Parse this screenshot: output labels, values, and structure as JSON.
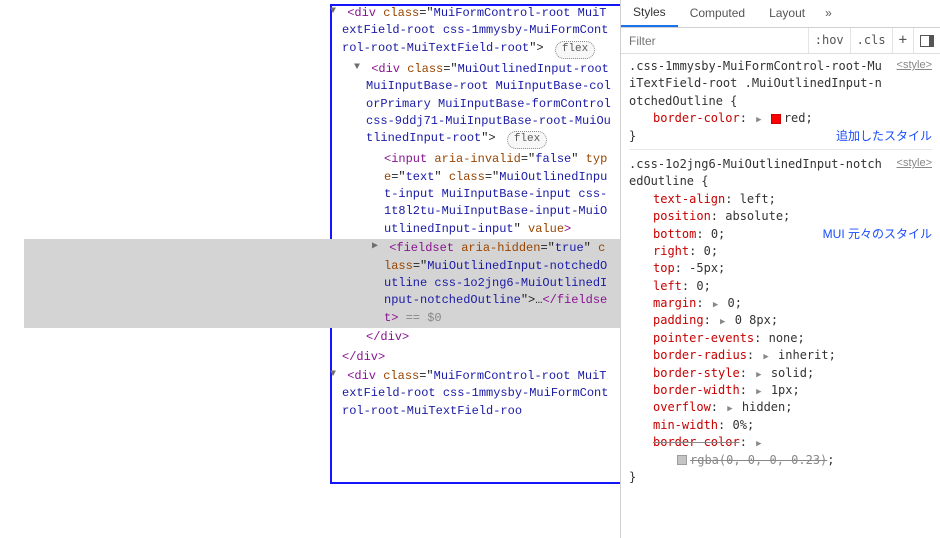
{
  "dom": {
    "div1_open_prefix": "<div class=\"",
    "div1_class": "MuiFormControl-root MuiTextField-root css-1mmysby-MuiFormControl-root-MuiTextField-root",
    "div1_open_suffix": "\">",
    "flex_badge": "flex",
    "div2_open_prefix": "<div class=\"",
    "div2_class": "MuiOutlinedInput-root MuiInputBase-root MuiInputBase-colorPrimary MuiInputBase-formControl css-9ddj71-MuiInputBase-root-MuiOutlinedInput-root",
    "div2_open_suffix": "\">",
    "input_open": "<input ",
    "input_attr1_name": "aria-invalid",
    "input_attr1_val": "false",
    "input_attr2_name": "type",
    "input_attr2_val": "text",
    "input_attr3_name": "class",
    "input_attr3_val": "MuiOutlinedInput-input MuiInputBase-input css-1t8l2tu-MuiInputBase-input-MuiOutlinedInput-input",
    "input_attr4_name": "value",
    "input_close": ">",
    "fieldset_open": "<fieldset ",
    "fieldset_attr1_name": "aria-hidden",
    "fieldset_attr1_val": "true",
    "fieldset_attr2_name": "class",
    "fieldset_attr2_val": "MuiOutlinedInput-notchedOutline css-1o2jng6-MuiOutlinedInput-notchedOutline",
    "fieldset_close_open": "\">",
    "fieldset_ellipsis": "…",
    "fieldset_end": "</fieldset>",
    "eq_selected": " == $0",
    "div_end": "</div>",
    "second_div1_open_prefix": "<div class=\"",
    "second_div1_class_partial": "MuiFormControl-root MuiTextField-root css-1mmysby-MuiFormControl-root-MuiTextField-roo"
  },
  "styles": {
    "tabs": {
      "styles": "Styles",
      "computed": "Computed",
      "layout": "Layout",
      "overflow": "»"
    },
    "filter": {
      "placeholder": "Filter",
      "hov": ":hov",
      "cls": ".cls",
      "plus": "+"
    },
    "rule1": {
      "selector": ".css-1mmysby-MuiFormControl-root-MuiTextField-root .MuiOutlinedInput-notchedOutline",
      "source": "<style>",
      "open_brace": " {",
      "decl1_prop": "border-color",
      "decl1_val": "red",
      "close_brace": "}",
      "annotation": "追加したスタイル"
    },
    "rule2": {
      "selector": ".css-1o2jng6-MuiOutlinedInput-notchedOutline",
      "source": "<style>",
      "open_brace": " {",
      "annotation": "MUI 元々のスタイル",
      "decls": [
        {
          "prop": "text-align",
          "val": "left"
        },
        {
          "prop": "position",
          "val": "absolute"
        },
        {
          "prop": "bottom",
          "val": "0"
        },
        {
          "prop": "right",
          "val": "0"
        },
        {
          "prop": "top",
          "val": "-5px"
        },
        {
          "prop": "left",
          "val": "0"
        },
        {
          "prop": "margin",
          "arrow": true,
          "val": "0"
        },
        {
          "prop": "padding",
          "arrow": true,
          "val": "0 8px"
        },
        {
          "prop": "pointer-events",
          "val": "none"
        },
        {
          "prop": "border-radius",
          "arrow": true,
          "val": "inherit"
        },
        {
          "prop": "border-style",
          "arrow": true,
          "val": "solid"
        },
        {
          "prop": "border-width",
          "arrow": true,
          "val": "1px"
        },
        {
          "prop": "overflow",
          "arrow": true,
          "val": "hidden"
        },
        {
          "prop": "min-width",
          "val": "0%"
        }
      ],
      "struck_prop": "border-color",
      "struck_val": "rgba(0, 0, 0, 0.23)",
      "close_brace": "}"
    }
  }
}
